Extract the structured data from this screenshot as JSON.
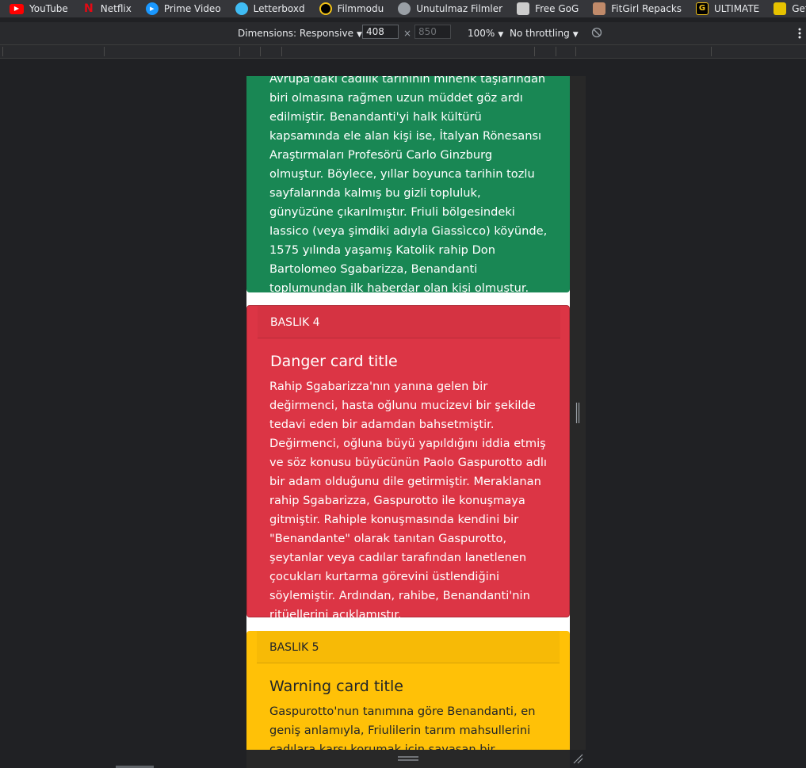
{
  "bookmarks": [
    {
      "label": "YouTube",
      "icon": "youtube-icon",
      "color": "#ff0000"
    },
    {
      "label": "Netflix",
      "icon": "netflix-icon",
      "color": "#e50914"
    },
    {
      "label": "Prime Video",
      "icon": "prime-video-icon",
      "color": "#1a98ff"
    },
    {
      "label": "Letterboxd",
      "icon": "letterboxd-icon",
      "color": "#40bcf4"
    },
    {
      "label": "Filmmodu",
      "icon": "filmmodu-icon",
      "color": "#f5c518"
    },
    {
      "label": "Unutulmaz Filmler",
      "icon": "globe-icon",
      "color": "#9aa0a6"
    },
    {
      "label": "Free GoG",
      "icon": "freegog-icon",
      "color": "#cccccc"
    },
    {
      "label": "FitGirl Repacks",
      "icon": "fitgirl-icon",
      "color": "#c08a6a"
    },
    {
      "label": "ULTIMATE",
      "icon": "ultimate-icon",
      "color": "#f5c518"
    },
    {
      "label": "GetComics",
      "icon": "getcomics-icon",
      "color": "#e6c200"
    }
  ],
  "devtools": {
    "dimensions_label": "Dimensions: Responsive",
    "width_value": "408",
    "height_value": "850",
    "times": "×",
    "zoom": "100%",
    "throttling": "No throttling"
  },
  "cards": {
    "success": {
      "text": "Avrupa'daki cadılık tarihinin mihenk taşlarından biri olmasına rağmen uzun müddet göz ardı edilmiştir. Benandanti'yi halk kültürü kapsamında ele alan kişi ise, İtalyan Rönesansı Araştırmaları Profesörü Carlo Ginzburg olmuştur. Böylece, yıllar boyunca tarihin tozlu sayfalarında kalmış bu gizli topluluk, günyüzüne çıkarılmıştır. Friuli bölgesindeki Iassico (veya şimdiki adıyla Giassìcco) köyünde, 1575 yılında yaşamış Katolik rahip Don Bartolomeo Sgabarizza, Benandanti toplumundan ilk haberdar olan kişi olmuştur."
    },
    "danger": {
      "header": "BASLIK 4",
      "title": "Danger card title",
      "text": "Rahip Sgabarizza'nın yanına gelen bir değirmenci, hasta oğlunu mucizevi bir şekilde tedavi eden bir adamdan bahsetmiştir. Değirmenci, oğluna büyü yapıldığını iddia etmiş ve söz konusu büyücünün Paolo Gaspurotto adlı bir adam olduğunu dile getirmiştir. Meraklanan rahip Sgabarizza, Gaspurotto ile konuşmaya gitmiştir. Rahiple konuşmasında kendini bir \"Benandante\" olarak tanıtan Gaspurotto, şeytanlar veya cadılar tarafından lanetlenen çocukları kurtarma görevini üstlendiğini söylemiştir. Ardından, rahibe, Benandanti'nin ritüellerini açıklamıştır."
    },
    "warning": {
      "header": "BASLIK 5",
      "title": "Warning card title",
      "text": "Gaspurotto'nun tanımına göre Benandanti, en geniş anlamıyla, Friulilerin tarım mahsullerini cadılara karşı korumak için savaşan bir"
    }
  }
}
